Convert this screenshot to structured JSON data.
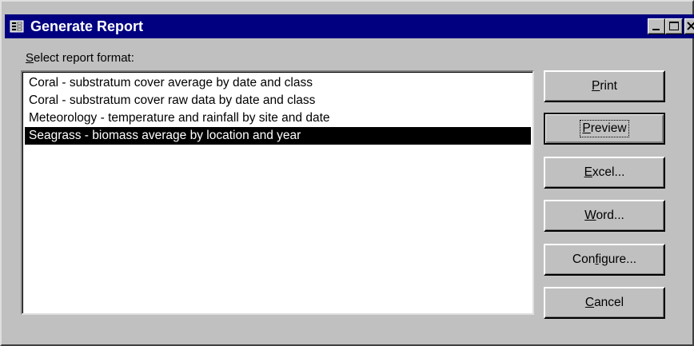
{
  "window": {
    "title": "Generate Report",
    "icon": "form-icon",
    "controls": [
      "minimize",
      "maximize",
      "close"
    ]
  },
  "label": {
    "mnemonic": "S",
    "rest": "elect report format:"
  },
  "reports": [
    "Coral - substratum cover average by date and class",
    "Coral - substratum cover raw data by date and class",
    "Meteorology - temperature and rainfall by site and date",
    "Seagrass - biomass average by location and year"
  ],
  "selected_report": "Seagrass - biomass average by location and year",
  "buttons": {
    "print": {
      "pre": "",
      "mn": "P",
      "post": "rint"
    },
    "preview": {
      "pre": "",
      "mn": "P",
      "post": "review"
    },
    "excel": {
      "pre": "",
      "mn": "E",
      "post": "xcel..."
    },
    "word": {
      "pre": "",
      "mn": "W",
      "post": "ord..."
    },
    "configure": {
      "pre": "Con",
      "mn": "f",
      "post": "igure..."
    },
    "cancel": {
      "pre": "",
      "mn": "C",
      "post": "ancel"
    }
  },
  "colors": {
    "titlebar": "#000080",
    "face": "#c0c0c0",
    "selection": "#000000"
  }
}
